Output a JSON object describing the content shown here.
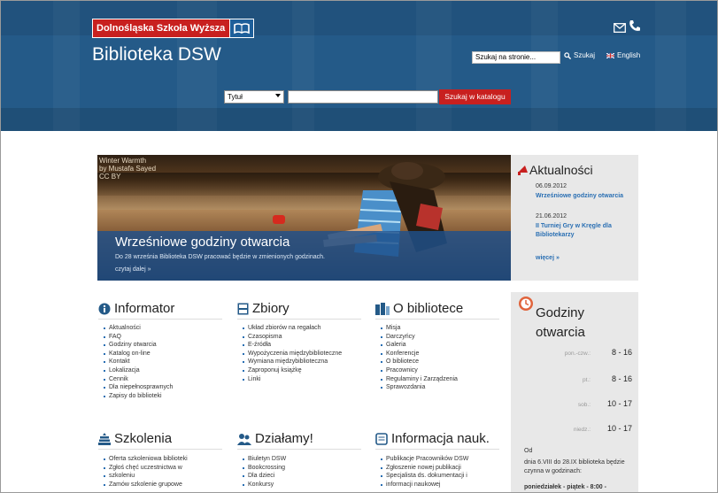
{
  "header": {
    "school_name": "Dolnośląska Szkoła Wyższa",
    "site_title": "Biblioteka DSW",
    "site_search_value": "Szukaj na stronie...",
    "site_search_button": "Szukaj",
    "language_link": "English",
    "catalog_select_value": "Tytuł",
    "catalog_search_button": "Szukaj w katalogu"
  },
  "banner": {
    "credit_line1": "Winter Warmth",
    "credit_line2": "by Mustafa Sayed",
    "credit_line3": "CC BY",
    "title": "Wrześniowe godziny otwarcia",
    "text": "Do 28 września Biblioteka DSW pracować będzie w zmienionych godzinach.",
    "more": "czytaj dalej »"
  },
  "news": {
    "title": "Aktualności",
    "items": [
      {
        "date": "06.09.2012",
        "title": "Wrześniowe godziny otwarcia"
      },
      {
        "date": "21.06.2012",
        "title": "II Turniej Gry w Kręgle dla Bibliotekarzy"
      }
    ],
    "more": "więcej »"
  },
  "sections": {
    "informator": {
      "title": "Informator",
      "items": [
        "Aktualności",
        "FAQ",
        "Godziny otwarcia",
        "Katalog on-line",
        "Kontakt",
        "Lokalizacja",
        "Cennik",
        "Dla niepełnosprawnych",
        "Zapisy do biblioteki"
      ]
    },
    "zbiory": {
      "title": "Zbiory",
      "items": [
        "Układ zbiorów na regałach",
        "Czasopisma",
        "E-źródła",
        "Wypożyczenia międzybiblioteczne",
        "Wymiana międzybiblioteczna",
        "Zaproponuj książkę",
        "Linki"
      ]
    },
    "o_bibliotece": {
      "title": "O bibliotece",
      "items": [
        "Misja",
        "Darczyńcy",
        "Galeria",
        "Konferencje",
        "O bibliotece",
        "Pracownicy",
        "Regulaminy i Zarządzenia",
        "Sprawozdania"
      ]
    },
    "szkolenia": {
      "title": "Szkolenia",
      "items": [
        "Oferta szkoleniowa biblioteki",
        "Zgłoś chęć uczestnictwa w",
        "szkoleniu",
        "Zamów szkolenie grupowe"
      ]
    },
    "dzialamy": {
      "title": "Działamy!",
      "items": [
        "Biuletyn DSW",
        "Bookcrossing",
        "Dla dzieci",
        "Konkursy"
      ]
    },
    "informacja": {
      "title": "Informacja nauk.",
      "items": [
        "Publikacje Pracowników DSW",
        "Zgłoszenie nowej publikacji",
        "Specjalista ds. dokumentacji i",
        "informacji naukowej"
      ]
    }
  },
  "hours": {
    "title1": "Godziny",
    "title2": "otwarcia",
    "rows": [
      {
        "day": "pon.-czw.:",
        "value": "8 - 16"
      },
      {
        "day": "pt.:",
        "value": "8 - 16"
      },
      {
        "day": "sob.:",
        "value": "10 - 17"
      },
      {
        "day": "niedz.:",
        "value": "10 - 17"
      }
    ],
    "od": "Od",
    "dates": "dnia 6.VIII do 28.IX biblioteka będzie czynna w godzinach:",
    "last": "poniedziałek - piątek - 8:00 -"
  },
  "colors": {
    "header_blue": "#245a88",
    "accent_red": "#c8201f",
    "link_blue": "#2a6fb3",
    "panel_gray": "#e8e8e8"
  }
}
